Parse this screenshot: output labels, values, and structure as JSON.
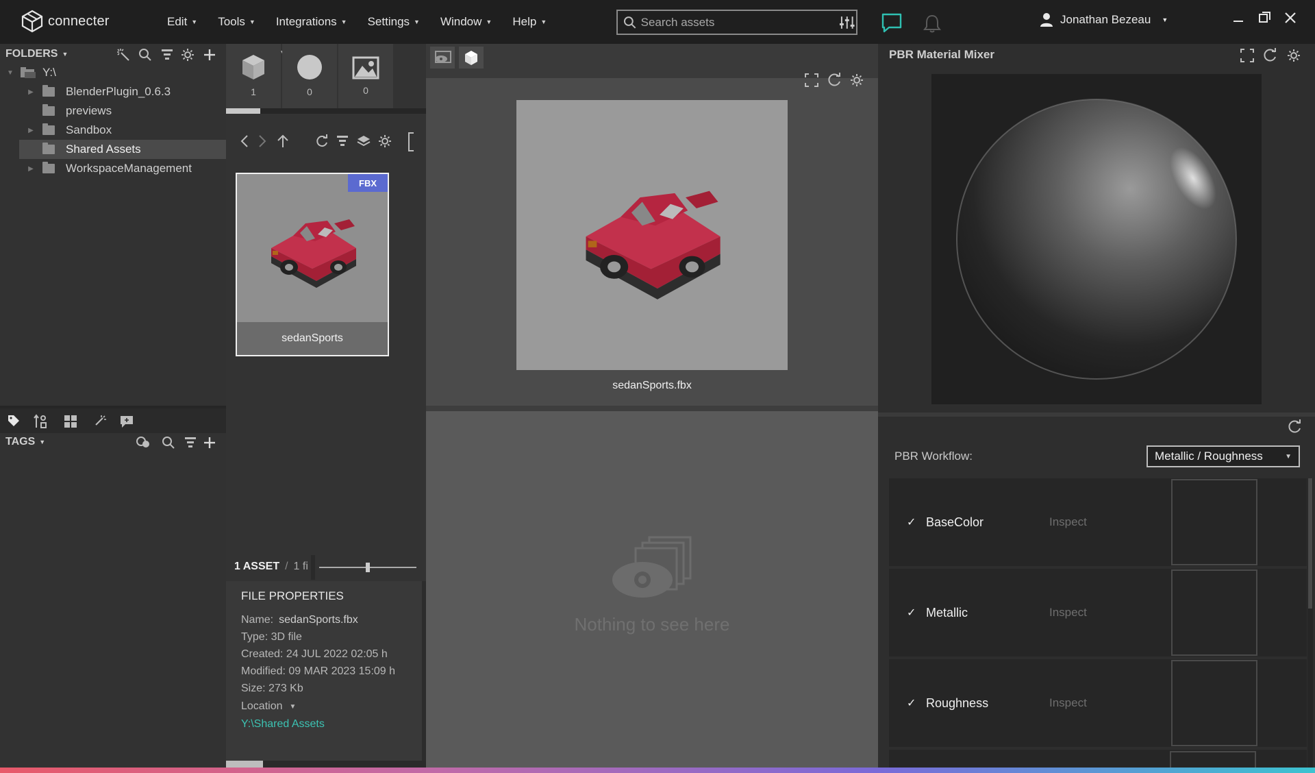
{
  "app": {
    "logo_text": "connecter"
  },
  "menu": {
    "items": [
      "Edit",
      "Tools",
      "Integrations",
      "Settings",
      "Window",
      "Help"
    ]
  },
  "search": {
    "placeholder": "Search assets"
  },
  "user": {
    "name": "Jonathan Bezeau"
  },
  "folders": {
    "header": "FOLDERS",
    "root": "Y:\\",
    "items": [
      {
        "label": "BlenderPlugin_0.6.3",
        "expandable": true
      },
      {
        "label": "previews",
        "expandable": false
      },
      {
        "label": "Sandbox",
        "expandable": true
      },
      {
        "label": "Shared Assets",
        "expandable": false,
        "selected": true
      },
      {
        "label": "WorkspaceManagement",
        "expandable": true
      }
    ]
  },
  "tags": {
    "header": "TAGS"
  },
  "type_tabs": [
    {
      "icon": "cube-icon",
      "count": "1"
    },
    {
      "icon": "sphere-icon",
      "count": "0"
    },
    {
      "icon": "image-icon",
      "count": "0"
    }
  ],
  "asset_card": {
    "badge": "FBX",
    "name": "sedanSports"
  },
  "asset_count": {
    "label": "1 ASSET",
    "separator": "/",
    "files": "1 fi"
  },
  "file_properties": {
    "title": "FILE PROPERTIES",
    "name_label": "Name:",
    "name_value": "sedanSports.fbx",
    "type_line": "Type: 3D file",
    "created_line": "Created: 24 JUL 2022 02:05 h",
    "modified_line": "Modified: 09 MAR 2023 15:09 h",
    "size_line": "Size: 273 Kb",
    "location_label": "Location",
    "location_value": "Y:\\Shared Assets"
  },
  "viewer": {
    "preview_caption": "sedanSports.fbx",
    "empty_message": "Nothing to see here"
  },
  "pbr": {
    "title": "PBR Material Mixer",
    "workflow_label": "PBR Workflow:",
    "workflow_value": "Metallic / Roughness",
    "channels": [
      {
        "name": "BaseColor",
        "inspect": "Inspect",
        "checked": true
      },
      {
        "name": "Metallic",
        "inspect": "Inspect",
        "checked": true
      },
      {
        "name": "Roughness",
        "inspect": "Inspect",
        "checked": true
      }
    ]
  },
  "colors": {
    "accent_teal": "#3cc3b3",
    "badge_blue": "#5b6ad0",
    "car_red": "#b52540",
    "chat_teal": "#2fc0b2"
  }
}
